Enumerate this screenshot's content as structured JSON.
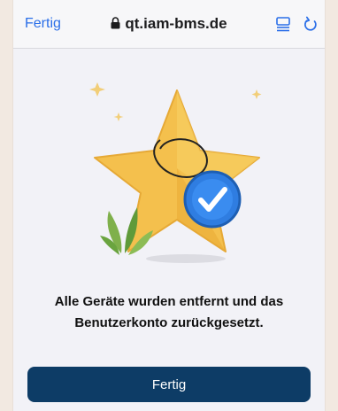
{
  "browser": {
    "done_label": "Fertig",
    "url": "qt.iam-bms.de",
    "icons": [
      "lock-icon",
      "reader-icon",
      "reload-icon"
    ],
    "accent": "#2a6ee8"
  },
  "illustration": {
    "icons": [
      "star-with-checkmark-illustration"
    ],
    "colors": {
      "star": "#f4c04d",
      "check_badge": "#2f7de1"
    }
  },
  "main": {
    "message_line1": "Alle Geräte wurden entfernt und das",
    "message_line2": "Benutzerkonto zurückgesetzt.",
    "button_label": "Fertig",
    "button_color": "#0d3c66"
  }
}
